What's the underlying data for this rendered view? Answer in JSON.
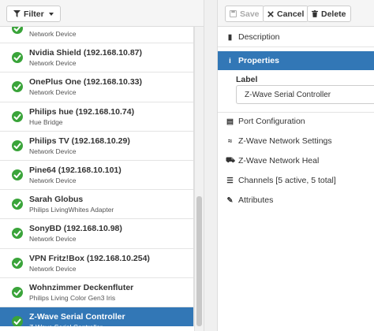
{
  "left_toolbar": {
    "filter_label": "Filter"
  },
  "devices": [
    {
      "name": "",
      "type": "Network Device",
      "selected": false
    },
    {
      "name": "Nvidia Shield (192.168.10.87)",
      "type": "Network Device",
      "selected": false
    },
    {
      "name": "OnePlus One (192.168.10.33)",
      "type": "Network Device",
      "selected": false
    },
    {
      "name": "Philips hue (192.168.10.74)",
      "type": "Hue Bridge",
      "selected": false
    },
    {
      "name": "Philips TV (192.168.10.29)",
      "type": "Network Device",
      "selected": false
    },
    {
      "name": "Pine64 (192.168.10.101)",
      "type": "Network Device",
      "selected": false
    },
    {
      "name": "Sarah Globus",
      "type": "Philips LivingWhites Adapter",
      "selected": false
    },
    {
      "name": "SonyBD (192.168.10.98)",
      "type": "Network Device",
      "selected": false
    },
    {
      "name": "VPN Fritz!Box (192.168.10.254)",
      "type": "Network Device",
      "selected": false
    },
    {
      "name": "Wohnzimmer Deckenfluter",
      "type": "Philips Living Color Gen3 Iris",
      "selected": false
    },
    {
      "name": "Z-Wave Serial Controller",
      "type": "Z-Wave Serial Controller",
      "selected": true
    }
  ],
  "right_toolbar": {
    "save_label": "Save",
    "cancel_label": "Cancel",
    "delete_label": "Delete"
  },
  "sections": {
    "description": "Description",
    "properties": "Properties",
    "port_configuration": "Port Configuration",
    "zwave_network_settings": "Z-Wave Network Settings",
    "zwave_network_heal": "Z-Wave Network Heal",
    "channels": "Channels [5 active, 5 total]",
    "attributes": "Attributes"
  },
  "properties": {
    "label_caption": "Label",
    "label_value": "Z-Wave Serial Controller"
  },
  "colors": {
    "selected_bg": "#3277b6",
    "status_ok": "#3aa43a"
  }
}
